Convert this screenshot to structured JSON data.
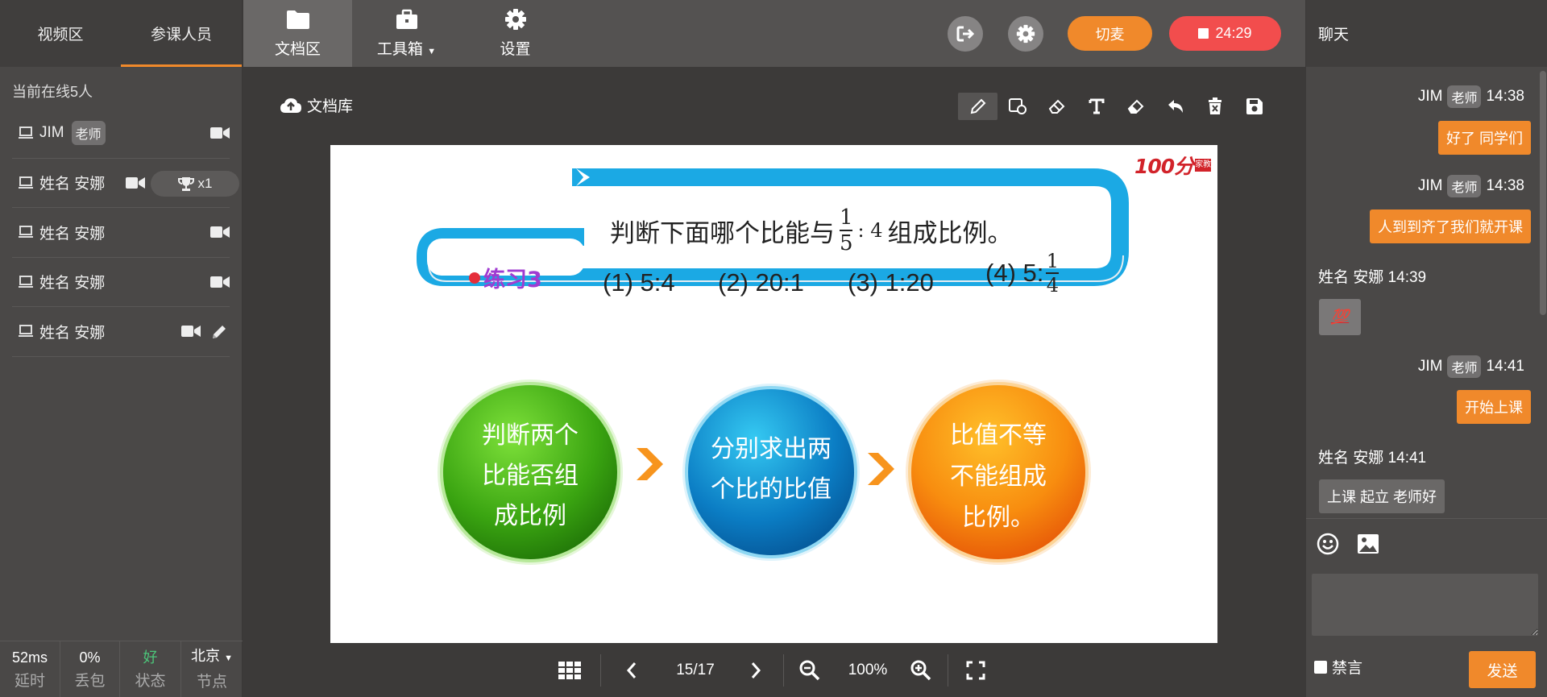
{
  "left": {
    "tabs": [
      {
        "label": "视频区"
      },
      {
        "label": "参课人员"
      }
    ],
    "online_text": "当前在线5人",
    "participants": [
      {
        "name": "JIM",
        "badge": "老师"
      },
      {
        "name": "姓名 安娜",
        "trophy": "x1"
      },
      {
        "name": "姓名 安娜"
      },
      {
        "name": "姓名 安娜"
      },
      {
        "name": "姓名 安娜"
      }
    ],
    "stats": [
      {
        "value": "52ms",
        "label": "延时"
      },
      {
        "value": "0%",
        "label": "丢包"
      },
      {
        "value": "好",
        "label": "状态"
      },
      {
        "value": "北京",
        "label": "节点"
      }
    ]
  },
  "topbar": {
    "items": [
      {
        "label": "文档区"
      },
      {
        "label": "工具箱"
      },
      {
        "label": "设置"
      }
    ],
    "switch_mic": "切麦",
    "timer": "24:29",
    "colors": {
      "accent": "#f0892b",
      "danger": "#f24d4d"
    }
  },
  "main": {
    "doc_library": "文档库",
    "tools": [
      "pen-icon",
      "shape-icon",
      "eraser-icon",
      "text-icon",
      "clear-icon",
      "undo-icon",
      "delete-icon",
      "save-icon"
    ],
    "pager": {
      "page": "15/17",
      "zoom": "100%"
    },
    "slide": {
      "brand": "100分",
      "brand_sub": "家教",
      "exercise": "练习3",
      "question": "判断下面哪个比能与",
      "question_suffix": "组成比例。",
      "frac1_num": "1",
      "frac1_den": "5",
      "ratio_rhs": ": 4",
      "options": [
        "(1) 5:4",
        "(2) 20:1",
        "(3) 1:20",
        "(4) 5:"
      ],
      "opt4_num": "1",
      "opt4_den": "4",
      "steps": [
        [
          "判断两个",
          "比能否组",
          "成比例"
        ],
        [
          "分别求出两",
          "个比的比值"
        ],
        [
          "比值不等",
          "不能组成",
          "比例。"
        ]
      ]
    }
  },
  "chat": {
    "title": "聊天",
    "messages": [
      {
        "sender": "JIM",
        "tag": "老师",
        "time": "14:38",
        "text": "好了 同学们"
      },
      {
        "sender": "JIM",
        "tag": "老师",
        "time": "14:38",
        "text": "人到到齐了我们就开课"
      },
      {
        "header": "姓名 安娜 14:39",
        "text": "💯"
      },
      {
        "sender": "JIM",
        "tag": "老师",
        "time": "14:41",
        "text": "开始上课"
      },
      {
        "header": "姓名 安娜 14:41",
        "text": "上课 起立 老师好"
      }
    ],
    "mute_label": "禁言",
    "send_label": "发送"
  }
}
